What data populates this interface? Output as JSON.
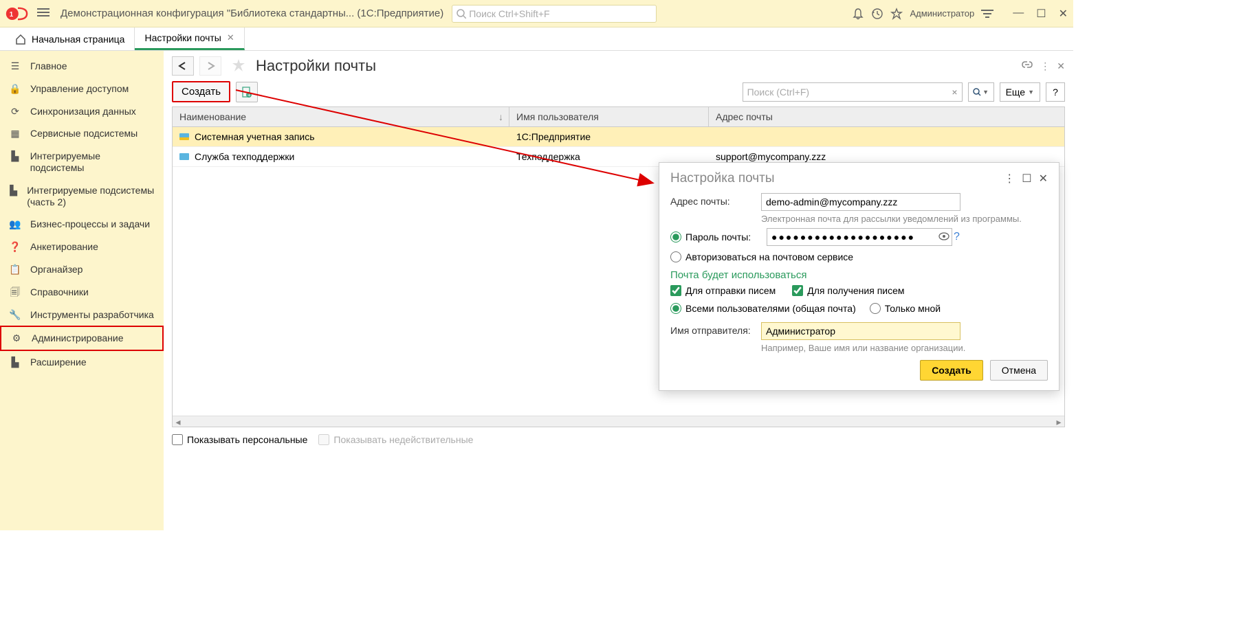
{
  "titlebar": {
    "app_title": "Демонстрационная конфигурация \"Библиотека стандартны...  (1С:Предприятие)",
    "search_placeholder": "Поиск Ctrl+Shift+F",
    "user": "Администратор"
  },
  "tabs": {
    "home": "Начальная страница",
    "active": "Настройки почты"
  },
  "sidebar": {
    "items": [
      "Главное",
      "Управление доступом",
      "Синхронизация данных",
      "Сервисные подсистемы",
      "Интегрируемые подсистемы",
      "Интегрируемые подсистемы (часть 2)",
      "Бизнес-процессы и задачи",
      "Анкетирование",
      "Органайзер",
      "Справочники",
      "Инструменты разработчика",
      "Администрирование",
      "Расширение"
    ]
  },
  "page": {
    "title": "Настройки почты"
  },
  "toolbar": {
    "create": "Создать",
    "search_placeholder": "Поиск (Ctrl+F)",
    "more": "Еще"
  },
  "table": {
    "col1": "Наименование",
    "col2": "Имя пользователя",
    "col3": "Адрес почты",
    "rows": [
      {
        "name": "Системная учетная запись",
        "user": "1С:Предприятие",
        "email": ""
      },
      {
        "name": "Служба техподдержки",
        "user": "Техподдержка",
        "email": "support@mycompany.zzz"
      }
    ]
  },
  "bottom": {
    "show_personal": "Показывать персональные",
    "show_inactive": "Показывать недействительные"
  },
  "dialog": {
    "title": "Настройка почты",
    "email_label": "Адрес почты:",
    "email_value": "demo-admin@mycompany.zzz",
    "email_hint": "Электронная почта для рассылки уведомлений из программы.",
    "pwd_radio": "Пароль почты:",
    "pwd_value": "●●●●●●●●●●●●●●●●●●●●",
    "auth_radio": "Авторизоваться на почтовом сервисе",
    "usage_title": "Почта будет использоваться",
    "send_check": "Для отправки писем",
    "recv_check": "Для получения писем",
    "all_users_radio": "Всеми пользователями (общая почта)",
    "only_me_radio": "Только мной",
    "sender_label": "Имя отправителя:",
    "sender_value": "Администратор",
    "sender_hint": "Например, Ваше имя или название организации.",
    "create_btn": "Создать",
    "cancel_btn": "Отмена"
  }
}
